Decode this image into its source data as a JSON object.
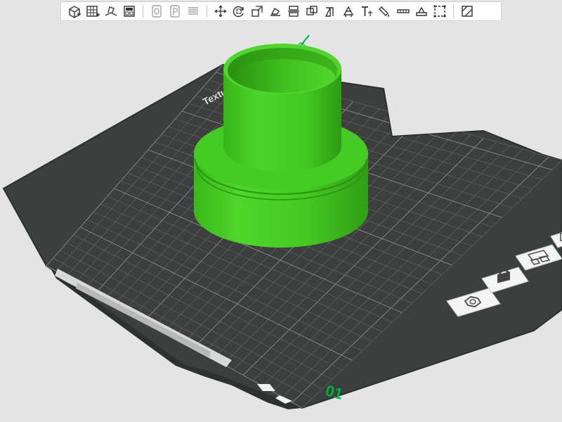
{
  "app": {
    "accent_color": "#00ae42",
    "plate_color": "#3d3e3e",
    "grid_color": "#6a6a6a",
    "background_color": "#e4e4e4",
    "object_color": "#3ed21a"
  },
  "toolbar": {
    "groups": [
      [
        {
          "name": "add-object-icon",
          "icon": "cube-plus"
        },
        {
          "name": "add-plate-icon",
          "icon": "grid-plus"
        },
        {
          "name": "auto-orient-icon",
          "icon": "orient"
        },
        {
          "name": "arrange-icon",
          "icon": "arrange"
        }
      ],
      [
        {
          "name": "split-objects-icon",
          "icon": "doc-0",
          "dim": true
        },
        {
          "name": "split-parts-icon",
          "icon": "doc-p",
          "dim": true
        },
        {
          "name": "layers-icon",
          "icon": "layers",
          "dim": true
        }
      ],
      [
        {
          "name": "move-icon",
          "icon": "move"
        },
        {
          "name": "rotate-icon",
          "icon": "rotate"
        },
        {
          "name": "scale-icon",
          "icon": "scale"
        },
        {
          "name": "lay-on-face-icon",
          "icon": "lay"
        },
        {
          "name": "cut-icon",
          "icon": "cut"
        },
        {
          "name": "boolean-icon",
          "icon": "boolean"
        },
        {
          "name": "measure-icon",
          "icon": "measure"
        },
        {
          "name": "support-paint-icon",
          "icon": "support"
        },
        {
          "name": "text-shape-icon",
          "icon": "text"
        },
        {
          "name": "color-paint-icon",
          "icon": "paint"
        },
        {
          "name": "seam-paint-icon",
          "icon": "seam"
        },
        {
          "name": "emboss-icon",
          "icon": "emboss"
        },
        {
          "name": "assembly-icon",
          "icon": "assembly"
        }
      ],
      [
        {
          "name": "view-mode-icon",
          "icon": "viewmode"
        }
      ]
    ]
  },
  "plate": {
    "name_label": "Textured PEI Plate",
    "plate_number": "01",
    "axis_marker": "0",
    "side_buttons": [
      {
        "name": "orient-plate-icon",
        "icon": "hex-nut"
      },
      {
        "name": "lock-plate-icon",
        "icon": "padlock"
      },
      {
        "name": "arrange-plate-icon",
        "icon": "arrange"
      },
      {
        "name": "plate-settings-icon",
        "icon": "settings"
      }
    ]
  }
}
